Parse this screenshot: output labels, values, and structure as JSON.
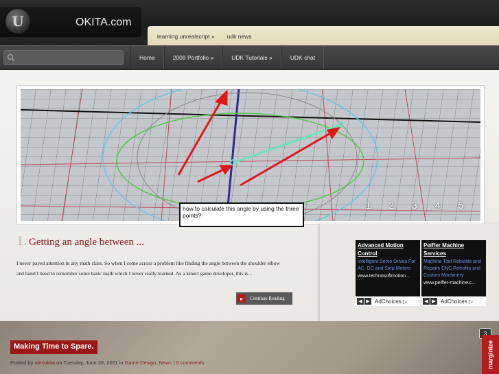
{
  "header": {
    "site_name": "OKITA.com",
    "logo_letter": "U",
    "subnav": [
      "learning unrealscript »",
      "udk news"
    ]
  },
  "nav": {
    "search_placeholder": "",
    "items": [
      "Home",
      "2009 Portfolio »",
      "UDK Tutorials »",
      "UDK chat"
    ]
  },
  "slider": {
    "caption": "how to calculate this angle by using the three points?",
    "dots": [
      "1.",
      "2.",
      "3.",
      "4.",
      "5."
    ]
  },
  "post": {
    "number": "1.",
    "title": "Getting an angle between ...",
    "excerpt": "I never payed attention in any math class.  So when I come across a problem like finding the angle between the shoulder elbow and hand I need to remember some basic math which I never really learned. As a kinect game developer, this is...",
    "read_more": "Continue Reading"
  },
  "ads": [
    {
      "title": "Advanced Motion Control",
      "body": "Intelligent Servo Drives For AC, DC and Step Motors",
      "url": "www.technosoftmotion...",
      "choices": "AdChoices ▷"
    },
    {
      "title": "Peiffer Machine Services",
      "body": "Machine Tool Rebuilds and Repairs CNC Retrofits and Custom Machinery",
      "url": "www.peiffer-machine.c...",
      "choices": "AdChoices ▷"
    }
  ],
  "lower": {
    "title": "Making Time to Spare.",
    "meta_prefix": "Posted by ",
    "author": "alexokita",
    "meta_on": " on Tuesday, June 28, 2011 in ",
    "categories": "Game Design, News",
    "separator": " | ",
    "comments": "0 comments",
    "comment_count": "3",
    "marginize": "marginize"
  },
  "colors": {
    "accent_red": "#9c1717",
    "nav_bg": "#3d3d3d",
    "subnav_bg": "#e8e1c4"
  }
}
